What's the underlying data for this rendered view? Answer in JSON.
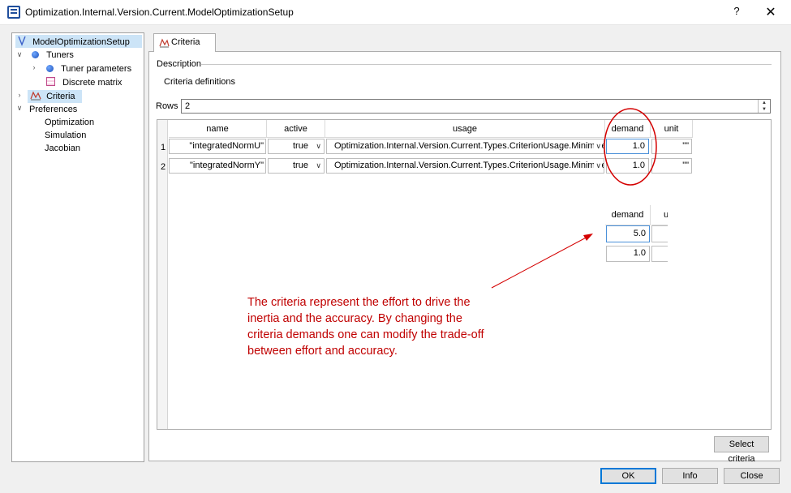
{
  "window": {
    "title": "Optimization.Internal.Version.Current.ModelOptimizationSetup",
    "help_label": "?",
    "close_label": "✕"
  },
  "tree": {
    "items": [
      {
        "label": "ModelOptimizationSetup",
        "icon": "function-icon"
      },
      {
        "label": "Tuners",
        "icon": "ball-icon"
      },
      {
        "label": "Tuner parameters",
        "icon": "ball-icon"
      },
      {
        "label": "Discrete matrix",
        "icon": "grid-icon"
      },
      {
        "label": "Criteria",
        "icon": "criteria-icon"
      },
      {
        "label": "Preferences"
      },
      {
        "label": "Optimization"
      },
      {
        "label": "Simulation"
      },
      {
        "label": "Jacobian"
      }
    ]
  },
  "tab": {
    "label": "Criteria"
  },
  "description": {
    "legend": "Description",
    "text": "Criteria definitions"
  },
  "rows": {
    "label": "Rows",
    "value": "2"
  },
  "table": {
    "headers": [
      "name",
      "active",
      "usage",
      "demand",
      "unit"
    ],
    "rows": [
      {
        "num": "1",
        "name": "\"integratedNormU\"",
        "active": "true",
        "usage": "Optimization.Internal.Version.Current.Types.CriterionUsage.Minimize",
        "demand": "1.0",
        "unit": "\"\""
      },
      {
        "num": "2",
        "name": "\"integratedNormY\"",
        "active": "true",
        "usage": "Optimization.Internal.Version.Current.Types.CriterionUsage.Minimize",
        "demand": "1.0",
        "unit": "\"\""
      }
    ]
  },
  "zoom_inset": {
    "header": "demand",
    "header_cut": "u",
    "values": [
      "5.0",
      "1.0"
    ]
  },
  "annotation": {
    "text": "The criteria represent the effort to drive the inertia and the accuracy. By changing the criteria demands one can modify the trade-off between effort and accuracy.",
    "color": "#c00000"
  },
  "buttons": {
    "select_criteria": "Select criteria",
    "ok": "OK",
    "info": "Info",
    "close": "Close"
  }
}
